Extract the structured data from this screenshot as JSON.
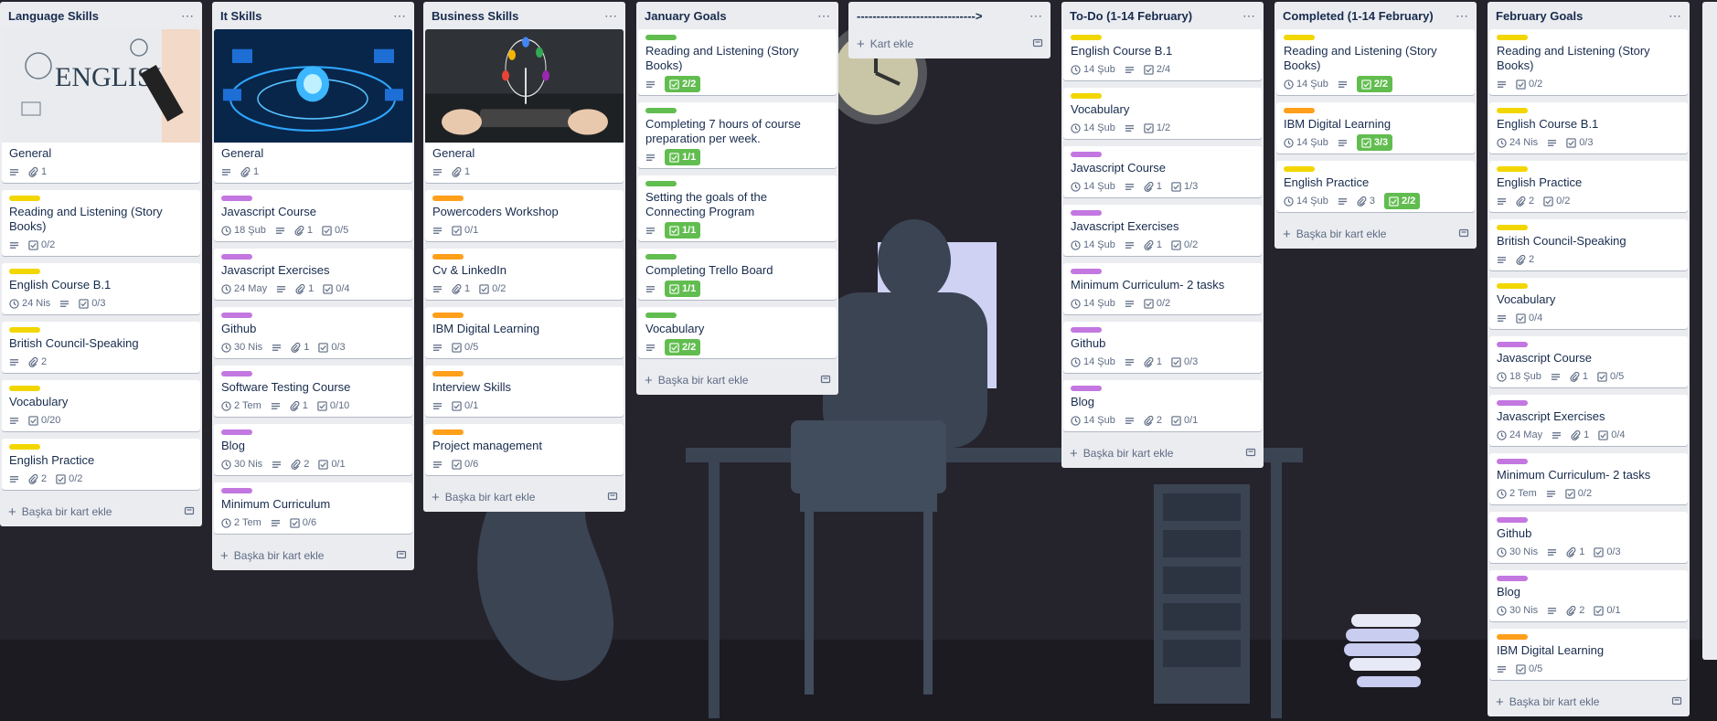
{
  "labels_colors": {
    "yellow": "#f2d600",
    "orange": "#ff9f1a",
    "purple": "#c377e0",
    "green": "#61bd4f"
  },
  "add_card_label": "Başka bir kart ekle",
  "lists": [
    {
      "title": "Language Skills",
      "add_label": "Başka bir kart ekle",
      "cards": [
        {
          "cover": "english-image",
          "title": "General",
          "label": null,
          "badges": [
            {
              "type": "desc"
            },
            {
              "type": "attach",
              "text": "1"
            }
          ]
        },
        {
          "title": "Reading and Listening (Story Books)",
          "label": "yellow",
          "badges": [
            {
              "type": "desc"
            },
            {
              "type": "check",
              "text": "0/2"
            }
          ]
        },
        {
          "title": "English Course B.1",
          "label": "yellow",
          "badges": [
            {
              "type": "due",
              "text": "24 Nis"
            },
            {
              "type": "desc"
            },
            {
              "type": "check",
              "text": "0/3"
            }
          ]
        },
        {
          "title": "British Council-Speaking",
          "label": "yellow",
          "badges": [
            {
              "type": "desc"
            },
            {
              "type": "attach",
              "text": "2"
            }
          ]
        },
        {
          "title": "Vocabulary",
          "label": "yellow",
          "badges": [
            {
              "type": "desc"
            },
            {
              "type": "check",
              "text": "0/20"
            }
          ]
        },
        {
          "title": "English Practice",
          "label": "yellow",
          "badges": [
            {
              "type": "desc"
            },
            {
              "type": "attach",
              "text": "2"
            },
            {
              "type": "check",
              "text": "0/2"
            }
          ]
        }
      ]
    },
    {
      "title": "It Skills",
      "add_label": "Başka bir kart ekle",
      "cards": [
        {
          "cover": "network-image",
          "title": "General",
          "label": null,
          "badges": [
            {
              "type": "desc"
            },
            {
              "type": "attach",
              "text": "1"
            }
          ]
        },
        {
          "title": "Javascript Course",
          "label": "purple",
          "badges": [
            {
              "type": "due",
              "text": "18 Şub"
            },
            {
              "type": "desc"
            },
            {
              "type": "attach",
              "text": "1"
            },
            {
              "type": "check",
              "text": "0/5"
            }
          ]
        },
        {
          "title": "Javascript Exercises",
          "label": "purple",
          "badges": [
            {
              "type": "due",
              "text": "24 May"
            },
            {
              "type": "desc"
            },
            {
              "type": "attach",
              "text": "1"
            },
            {
              "type": "check",
              "text": "0/4"
            }
          ]
        },
        {
          "title": "Github",
          "label": "purple",
          "badges": [
            {
              "type": "due",
              "text": "30 Nis"
            },
            {
              "type": "desc"
            },
            {
              "type": "attach",
              "text": "1"
            },
            {
              "type": "check",
              "text": "0/3"
            }
          ]
        },
        {
          "title": "Software Testing Course",
          "label": "purple",
          "badges": [
            {
              "type": "due",
              "text": "2 Tem"
            },
            {
              "type": "desc"
            },
            {
              "type": "attach",
              "text": "1"
            },
            {
              "type": "check",
              "text": "0/10"
            }
          ]
        },
        {
          "title": "Blog",
          "label": "purple",
          "badges": [
            {
              "type": "due",
              "text": "30 Nis"
            },
            {
              "type": "desc"
            },
            {
              "type": "attach",
              "text": "2"
            },
            {
              "type": "check",
              "text": "0/1"
            }
          ]
        },
        {
          "title": "Minimum Curriculum",
          "label": "purple",
          "badges": [
            {
              "type": "due",
              "text": "2 Tem"
            },
            {
              "type": "desc"
            },
            {
              "type": "check",
              "text": "0/6"
            }
          ]
        }
      ]
    },
    {
      "title": "Business Skills",
      "add_label": "Başka bir kart ekle",
      "cards": [
        {
          "cover": "business-image",
          "title": "General",
          "label": null,
          "badges": [
            {
              "type": "desc"
            },
            {
              "type": "attach",
              "text": "1"
            }
          ]
        },
        {
          "title": "Powercoders Workshop",
          "label": "orange",
          "badges": [
            {
              "type": "desc"
            },
            {
              "type": "check",
              "text": "0/1"
            }
          ]
        },
        {
          "title": "Cv & LinkedIn",
          "label": "orange",
          "badges": [
            {
              "type": "desc"
            },
            {
              "type": "attach",
              "text": "1"
            },
            {
              "type": "check",
              "text": "0/2"
            }
          ]
        },
        {
          "title": "IBM Digital Learning",
          "label": "orange",
          "badges": [
            {
              "type": "desc"
            },
            {
              "type": "check",
              "text": "0/5"
            }
          ]
        },
        {
          "title": "Interview Skills",
          "label": "orange",
          "badges": [
            {
              "type": "desc"
            },
            {
              "type": "check",
              "text": "0/1"
            }
          ]
        },
        {
          "title": "Project management",
          "label": "orange",
          "badges": [
            {
              "type": "desc"
            },
            {
              "type": "check",
              "text": "0/6"
            }
          ]
        }
      ]
    },
    {
      "title": "January Goals",
      "add_label": "Başka bir kart ekle",
      "cards": [
        {
          "title": "Reading and Listening (Story Books)",
          "label": "green",
          "badges": [
            {
              "type": "desc"
            },
            {
              "type": "check",
              "text": "2/2",
              "done": true
            }
          ]
        },
        {
          "title": "Completing 7 hours of course preparation per week.",
          "label": "green",
          "badges": [
            {
              "type": "desc"
            },
            {
              "type": "check",
              "text": "1/1",
              "done": true
            }
          ]
        },
        {
          "title": "Setting the goals of the Connecting Program",
          "label": "green",
          "badges": [
            {
              "type": "desc"
            },
            {
              "type": "check",
              "text": "1/1",
              "done": true
            }
          ]
        },
        {
          "title": "Completing Trello Board",
          "label": "green",
          "badges": [
            {
              "type": "desc"
            },
            {
              "type": "check",
              "text": "1/1",
              "done": true
            }
          ]
        },
        {
          "title": "Vocabulary",
          "label": "green",
          "badges": [
            {
              "type": "desc"
            },
            {
              "type": "check",
              "text": "2/2",
              "done": true
            }
          ]
        }
      ]
    },
    {
      "title": "------------------------------>",
      "add_label": "Kart ekle",
      "cards": []
    },
    {
      "title": "To-Do (1-14 February)",
      "add_label": "Başka bir kart ekle",
      "cards": [
        {
          "title": "English Course B.1",
          "label": "yellow",
          "badges": [
            {
              "type": "due",
              "text": "14 Şub"
            },
            {
              "type": "desc"
            },
            {
              "type": "check",
              "text": "2/4"
            }
          ]
        },
        {
          "title": "Vocabulary",
          "label": "yellow",
          "badges": [
            {
              "type": "due",
              "text": "14 Şub"
            },
            {
              "type": "desc"
            },
            {
              "type": "check",
              "text": "1/2"
            }
          ]
        },
        {
          "title": "Javascript Course",
          "label": "purple",
          "badges": [
            {
              "type": "due",
              "text": "14 Şub"
            },
            {
              "type": "desc"
            },
            {
              "type": "attach",
              "text": "1"
            },
            {
              "type": "check",
              "text": "1/3"
            }
          ]
        },
        {
          "title": "Javascript Exercises",
          "label": "purple",
          "badges": [
            {
              "type": "due",
              "text": "14 Şub"
            },
            {
              "type": "desc"
            },
            {
              "type": "attach",
              "text": "1"
            },
            {
              "type": "check",
              "text": "0/2"
            }
          ]
        },
        {
          "title": "Minimum Curriculum- 2 tasks",
          "label": "purple",
          "badges": [
            {
              "type": "due",
              "text": "14 Şub"
            },
            {
              "type": "desc"
            },
            {
              "type": "check",
              "text": "0/2"
            }
          ]
        },
        {
          "title": "Github",
          "label": "purple",
          "badges": [
            {
              "type": "due",
              "text": "14 Şub"
            },
            {
              "type": "desc"
            },
            {
              "type": "attach",
              "text": "1"
            },
            {
              "type": "check",
              "text": "0/3"
            }
          ]
        },
        {
          "title": "Blog",
          "label": "purple",
          "badges": [
            {
              "type": "due",
              "text": "14 Şub"
            },
            {
              "type": "desc"
            },
            {
              "type": "attach",
              "text": "2"
            },
            {
              "type": "check",
              "text": "0/1"
            }
          ]
        }
      ]
    },
    {
      "title": "Completed (1-14 February)",
      "add_label": "Başka bir kart ekle",
      "cards": [
        {
          "title": "Reading and Listening (Story Books)",
          "label": "yellow",
          "badges": [
            {
              "type": "due",
              "text": "14 Şub"
            },
            {
              "type": "desc"
            },
            {
              "type": "check",
              "text": "2/2",
              "done": true
            }
          ]
        },
        {
          "title": "IBM Digital Learning",
          "label": "orange",
          "badges": [
            {
              "type": "due",
              "text": "14 Şub"
            },
            {
              "type": "desc"
            },
            {
              "type": "check",
              "text": "3/3",
              "done": true
            }
          ]
        },
        {
          "title": "English Practice",
          "label": "yellow",
          "badges": [
            {
              "type": "due",
              "text": "14 Şub"
            },
            {
              "type": "desc"
            },
            {
              "type": "attach",
              "text": "3"
            },
            {
              "type": "check",
              "text": "2/2",
              "done": true
            }
          ]
        }
      ]
    },
    {
      "title": "February Goals",
      "add_label": "Başka bir kart ekle",
      "cards": [
        {
          "title": "Reading and Listening (Story Books)",
          "label": "yellow",
          "badges": [
            {
              "type": "desc"
            },
            {
              "type": "check",
              "text": "0/2"
            }
          ]
        },
        {
          "title": "English Course B.1",
          "label": "yellow",
          "badges": [
            {
              "type": "due",
              "text": "24 Nis"
            },
            {
              "type": "desc"
            },
            {
              "type": "check",
              "text": "0/3"
            }
          ]
        },
        {
          "title": "English Practice",
          "label": "yellow",
          "badges": [
            {
              "type": "desc"
            },
            {
              "type": "attach",
              "text": "2"
            },
            {
              "type": "check",
              "text": "0/2"
            }
          ]
        },
        {
          "title": "British Council-Speaking",
          "label": "yellow",
          "badges": [
            {
              "type": "desc"
            },
            {
              "type": "attach",
              "text": "2"
            }
          ]
        },
        {
          "title": "Vocabulary",
          "label": "yellow",
          "badges": [
            {
              "type": "desc"
            },
            {
              "type": "check",
              "text": "0/4"
            }
          ]
        },
        {
          "title": "Javascript Course",
          "label": "purple",
          "badges": [
            {
              "type": "due",
              "text": "18 Şub"
            },
            {
              "type": "desc"
            },
            {
              "type": "attach",
              "text": "1"
            },
            {
              "type": "check",
              "text": "0/5"
            }
          ]
        },
        {
          "title": "Javascript Exercises",
          "label": "purple",
          "badges": [
            {
              "type": "due",
              "text": "24 May"
            },
            {
              "type": "desc"
            },
            {
              "type": "attach",
              "text": "1"
            },
            {
              "type": "check",
              "text": "0/4"
            }
          ]
        },
        {
          "title": "Minimum Curriculum- 2 tasks",
          "label": "purple",
          "badges": [
            {
              "type": "due",
              "text": "2 Tem"
            },
            {
              "type": "desc"
            },
            {
              "type": "check",
              "text": "0/2"
            }
          ]
        },
        {
          "title": "Github",
          "label": "purple",
          "badges": [
            {
              "type": "due",
              "text": "30 Nis"
            },
            {
              "type": "desc"
            },
            {
              "type": "attach",
              "text": "1"
            },
            {
              "type": "check",
              "text": "0/3"
            }
          ]
        },
        {
          "title": "Blog",
          "label": "purple",
          "badges": [
            {
              "type": "due",
              "text": "30 Nis"
            },
            {
              "type": "desc"
            },
            {
              "type": "attach",
              "text": "2"
            },
            {
              "type": "check",
              "text": "0/1"
            }
          ]
        },
        {
          "title": "IBM Digital Learning",
          "label": "orange",
          "badges": [
            {
              "type": "desc"
            },
            {
              "type": "check",
              "text": "0/5"
            }
          ]
        }
      ]
    }
  ]
}
